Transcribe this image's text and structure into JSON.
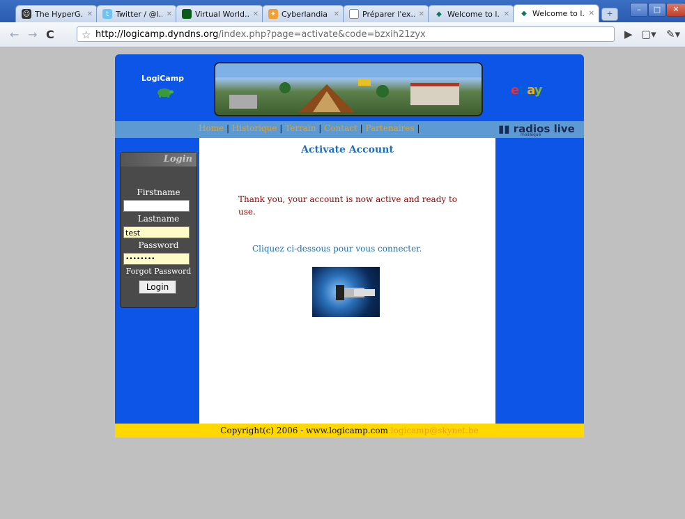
{
  "browser": {
    "tabs": [
      {
        "title": "The HyperG...",
        "icon": "globe-icon",
        "active": false
      },
      {
        "title": "Twitter / @l...",
        "icon": "twitter-icon",
        "active": false
      },
      {
        "title": "Virtual World...",
        "icon": "green-square-icon",
        "active": false
      },
      {
        "title": "Cyberlandia",
        "icon": "cyberlandia-icon",
        "active": false
      },
      {
        "title": "Préparer l'ex...",
        "icon": "page-icon",
        "active": false
      },
      {
        "title": "Welcome to l...",
        "icon": "turtle-icon",
        "active": false
      },
      {
        "title": "Welcome to l...",
        "icon": "turtle-icon",
        "active": true
      }
    ],
    "url_host": "http://logicamp.dyndns.org",
    "url_path": "/index.php?page=activate&code=bzxih21zyx"
  },
  "site": {
    "logo_text": "LogiCamp",
    "sponsor_logo": "ebay",
    "nav": [
      "Home",
      "Historique",
      "Terrain",
      "Contact",
      "Partenaires"
    ],
    "radios_label": "radios live",
    "radios_sub": "mosaïque",
    "footer_text": "Copyright(c) 2006 - www.logicamp.com",
    "footer_mail": "logicamp@skynet.be"
  },
  "login": {
    "header": "Login",
    "firstname_label": "Firstname",
    "firstname_value": "",
    "lastname_label": "Lastname",
    "lastname_value": "test",
    "password_label": "Password",
    "password_value": "••••••••",
    "forgot_label": "Forgot Password",
    "button_label": "Login"
  },
  "content": {
    "title": "Activate Account",
    "message": "Thank you, your account is now active and ready to use.",
    "cta": "Cliquez ci-dessous pour vous connecter."
  },
  "colors": {
    "site_blue": "#0d55e6",
    "nav_blue": "#5d9ad4",
    "footer_yellow": "#ffd800",
    "message_red": "#a00000",
    "title_blue": "#1c6fb8"
  }
}
